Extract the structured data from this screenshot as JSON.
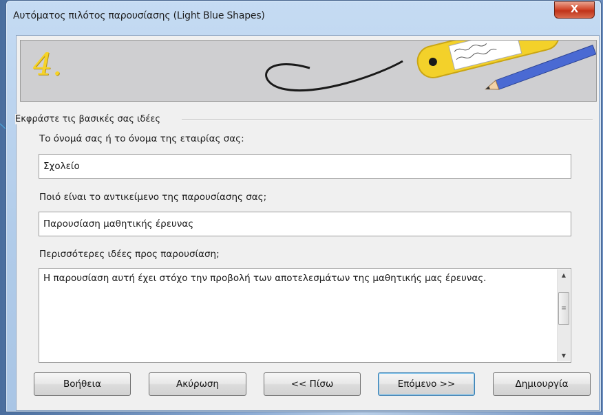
{
  "window": {
    "title": "Αυτόματος πιλότος παρουσίασης (Light Blue Shapes)",
    "close_label": "X"
  },
  "banner": {
    "step_number": "4."
  },
  "section": {
    "title": "Εκφράστε τις βασικές σας ιδέες"
  },
  "form": {
    "name_label": "Το όνομά σας ή το όνομα της εταιρίας σας:",
    "name_value": "Σχολείο",
    "subject_label": "Ποιό είναι το αντικείμενο της παρουσίασης σας;",
    "subject_value": "Παρουσίαση μαθητικής έρευνας",
    "ideas_label": "Περισσότερες ιδέες προς παρουσίαση;",
    "ideas_value": "Η παρουσίαση αυτή έχει στόχο την προβολή των αποτελεσμάτων της μαθητικής μας έρευνας."
  },
  "buttons": {
    "help": "Βοήθεια",
    "cancel": "Ακύρωση",
    "back": "<< Πίσω",
    "next": "Επόμενο >>",
    "create": "Δημιουργία"
  },
  "colors": {
    "accent": "#f6d327",
    "close_button": "#c0331a",
    "title_bar": "#b0cbe9"
  },
  "icons": {
    "close": "close-icon",
    "tag_illustration": "luggage-tag-icon",
    "pencil": "pencil-icon",
    "scroll_up": "arrow-up-icon",
    "scroll_down": "arrow-down-icon"
  }
}
